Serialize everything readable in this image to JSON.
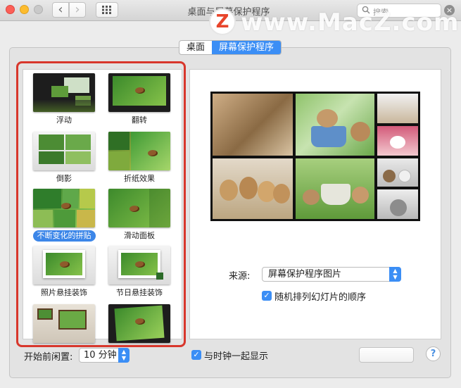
{
  "window": {
    "title": "桌面与屏幕保护程序",
    "search_placeholder": "搜索",
    "back_symbol": "‹",
    "forward_symbol": "›",
    "grid_symbol": "⋮⋮⋮",
    "close_symbol": "×"
  },
  "watermark": {
    "logo": "Z",
    "text": "www.MacZ.com"
  },
  "tabs": [
    {
      "label": "桌面",
      "active": false
    },
    {
      "label": "屏幕保护程序",
      "active": true
    }
  ],
  "savers": [
    {
      "label": "浮动",
      "style": "dark"
    },
    {
      "label": "翻转",
      "style": "dark"
    },
    {
      "label": "倒影",
      "style": "light"
    },
    {
      "label": "折纸效果",
      "style": "g3"
    },
    {
      "label": "不断变化的拼贴",
      "style": "g2",
      "selected": true
    },
    {
      "label": "滑动面板",
      "style": "g1"
    },
    {
      "label": "照片悬挂装饰",
      "style": "light"
    },
    {
      "label": "节日悬挂装饰",
      "style": "light"
    },
    {
      "label": "",
      "style": "room"
    },
    {
      "label": "",
      "style": "dark"
    }
  ],
  "preview": {
    "tiles": [
      "kitten",
      "bunnies in cup",
      "kittens",
      "white bunny",
      "puppies",
      "bunnies in grass",
      "bunnies",
      "kitten"
    ]
  },
  "source": {
    "label": "来源:",
    "value": "屏幕保护程序图片"
  },
  "shuffle": {
    "label": "随机排列幻灯片的顺序",
    "checked": true
  },
  "bottom": {
    "idle_label": "开始前闲置:",
    "idle_value": "10 分钟",
    "clock_label": "与时钟一起显示",
    "clock_checked": true,
    "help": "?"
  },
  "colors": {
    "accent": "#3b8ef5",
    "highlight": "#d8372c"
  }
}
